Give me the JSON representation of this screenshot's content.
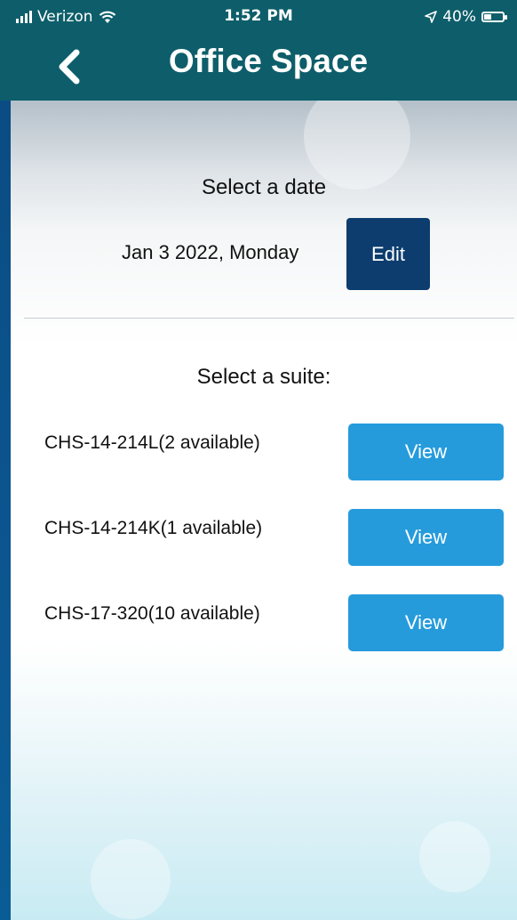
{
  "status_bar": {
    "carrier": "Verizon",
    "time": "1:52 PM",
    "battery": "40%",
    "battery_level": 0.4
  },
  "nav": {
    "title": "Office Space",
    "back_icon": "chevron-left-icon"
  },
  "date_section": {
    "heading": "Select a date",
    "date_value": "Jan 3 2022, Monday",
    "edit_label": "Edit"
  },
  "suite_section": {
    "heading": "Select a suite:",
    "suites": [
      {
        "label": "CHS-14-214L(2 available)",
        "button": "View"
      },
      {
        "label": "CHS-14-214K(1 available)",
        "button": "View"
      },
      {
        "label": "CHS-17-320(10 available)",
        "button": "View"
      }
    ]
  },
  "colors": {
    "nav_bg": "#0d5e6a",
    "edit_button": "#0c3d6e",
    "view_button": "#259bdc"
  }
}
